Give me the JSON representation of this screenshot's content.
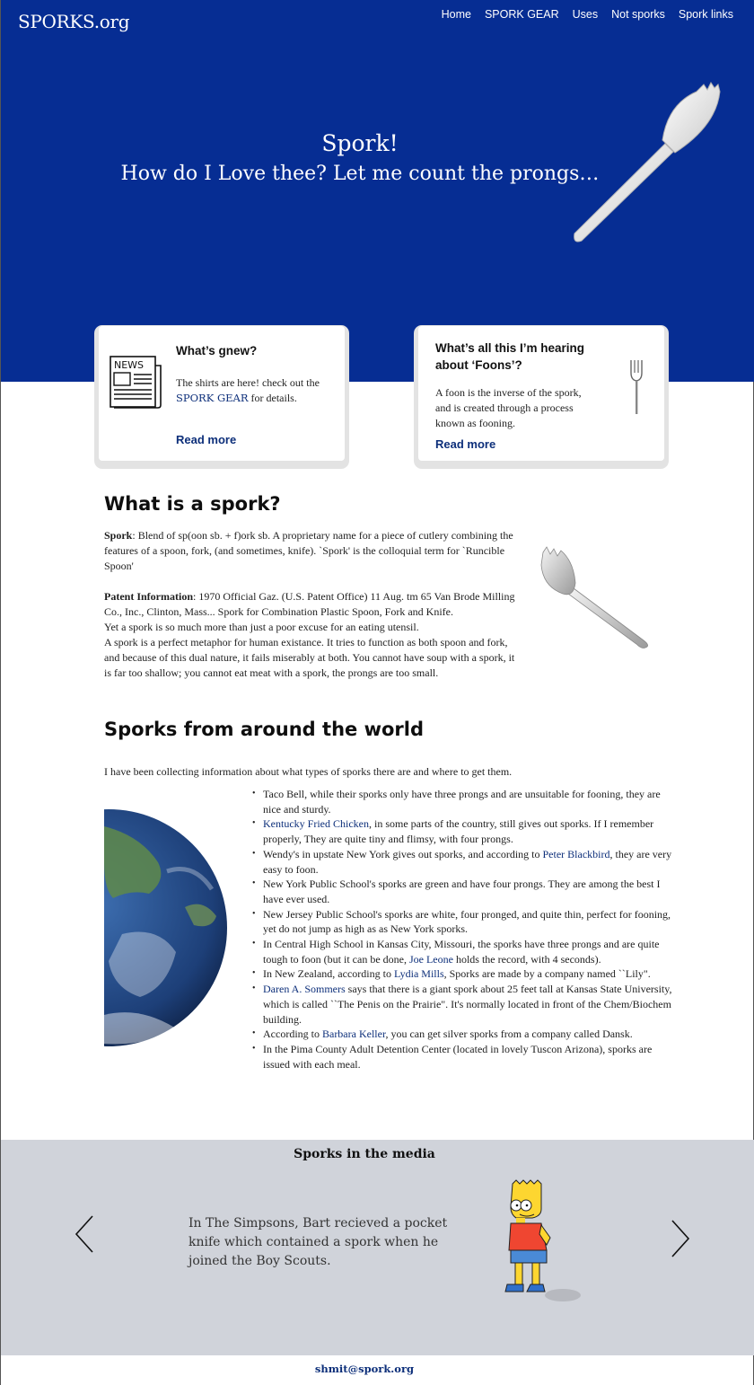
{
  "header": {
    "brand": "SPORKS.org",
    "nav": [
      "Home",
      "SPORK GEAR",
      "Uses",
      "Not sporks",
      "Spork links"
    ]
  },
  "hero": {
    "title": "Spork!",
    "subtitle": "How do I Love thee? Let me count the prongs…"
  },
  "cards": [
    {
      "title": "What’s gnew?",
      "text_before": "The shirts are here! check out the ",
      "link": "SPORK GEAR",
      "text_after": " for details.",
      "readmore": "Read more",
      "icon_label": "NEWS"
    },
    {
      "title": "What’s all this I’m hearing about ‘Foons’?",
      "text": "A foon is the inverse of the spork, and is created through a process known as fooning.",
      "readmore": "Read more"
    }
  ],
  "what_is": {
    "heading": "What is a spork?",
    "def_term": "Spork",
    "def_text": ": Blend of sp(oon sb. + f)ork sb. A proprietary name for a piece of cutlery combining the features of a spoon, fork, (and sometimes, knife). `Spork' is the colloquial term for `Runcible Spoon'",
    "patent_term": "Patent Information",
    "patent_text": ": 1970 Official Gaz. (U.S. Patent Office) 11 Aug. tm 65 Van Brode Milling Co., Inc., Clinton, Mass... Spork for Combination Plastic Spoon, Fork and Knife.",
    "line1": "Yet a spork is so much more than just a poor excuse for an eating utensil.",
    "line2": "A spork is a perfect metaphor for human existance. It tries to function as both spoon and fork, and because of this dual nature, it fails miserably at both. You cannot have soup with a spork, it is far too shallow; you cannot eat meat with a spork, the prongs are too small."
  },
  "world": {
    "heading": "Sporks from around the world",
    "intro": "I have been collecting information about what types of sporks there are and where to get them.",
    "items": [
      {
        "pre": "Taco Bell, while their sporks only have three prongs and are unsuitable for fooning, they are nice and sturdy.",
        "link": "",
        "post": ""
      },
      {
        "pre": "",
        "link": "Kentucky Fried Chicken",
        "post": ", in some parts of the country, still gives out sporks. If I remember properly, They are quite tiny and flimsy, with four prongs."
      },
      {
        "pre": "Wendy's in upstate New York gives out sporks, and according to ",
        "link": "Peter Blackbird",
        "post": ", they are very easy to foon."
      },
      {
        "pre": "New York Public School's sporks are green and have four prongs. They are among the best I have ever used.",
        "link": "",
        "post": ""
      },
      {
        "pre": "New Jersey Public School's sporks are white, four pronged, and quite thin, perfect for fooning, yet do not jump as high as as New York sporks.",
        "link": "",
        "post": ""
      },
      {
        "pre": "In Central High School in Kansas City, Missouri, the sporks have three prongs and are quite tough to foon (but it can be done, ",
        "link": "Joe Leone",
        "post": " holds the record, with 4 seconds)."
      },
      {
        "pre": "In New Zealand, according to ",
        "link": "Lydia Mills",
        "post": ", Sporks are made by a company named ``Lily\"."
      },
      {
        "pre": "",
        "link": "Daren A. Sommers",
        "post": " says that there is a giant spork about 25 feet tall at Kansas State University, which is called ``The Penis on the Prairie\". It's normally located in front of the Chem/Biochem building."
      },
      {
        "pre": "According to ",
        "link": "Barbara Keller",
        "post": ", you can get silver sporks from a company called Dansk."
      },
      {
        "pre": "In the Pima County Adult Detention Center (located in lovely Tuscon Arizona), sporks are issued with each meal.",
        "link": "",
        "post": ""
      }
    ]
  },
  "media": {
    "title": "Sporks in the media",
    "text": "In The Simpsons, Bart recieved a pocket knife which contained a spork when he joined the Boy Scouts."
  },
  "footer": {
    "email": "shmit@spork.org"
  },
  "colors": {
    "hero_bg": "#062d93",
    "link": "#0d2f7a",
    "media_bg": "#d0d3da"
  }
}
